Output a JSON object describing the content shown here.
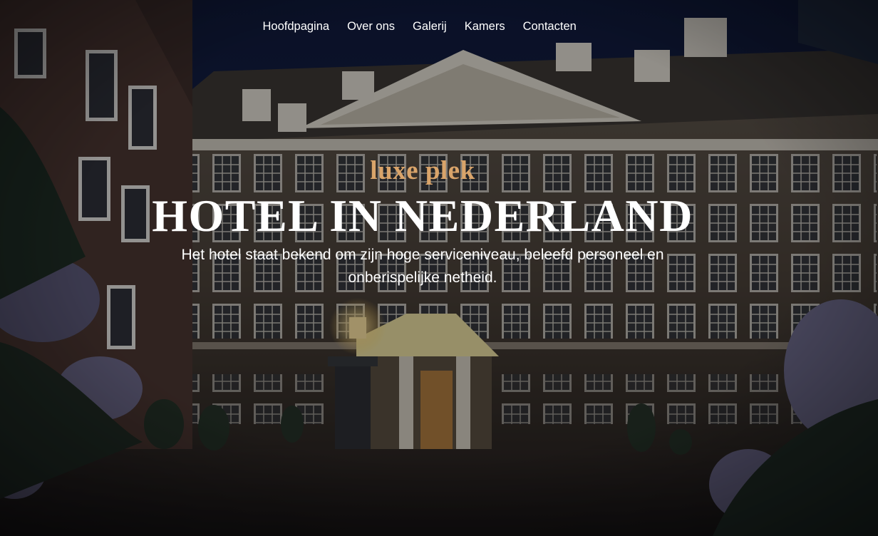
{
  "nav": {
    "items": [
      {
        "label": "Hoofdpagina"
      },
      {
        "label": "Over ons"
      },
      {
        "label": "Galerij"
      },
      {
        "label": "Kamers"
      },
      {
        "label": "Contacten"
      }
    ]
  },
  "hero": {
    "tagline": "luxe plek",
    "headline": "HOTEL IN NEDERLAND",
    "description": "Het hotel staat bekend om zijn hoge serviceniveau, beleefd personeel en onberispelijke netheid."
  },
  "colors": {
    "accent": "#d9a46a",
    "text": "#ffffff",
    "sky": "#0f1a3c"
  }
}
